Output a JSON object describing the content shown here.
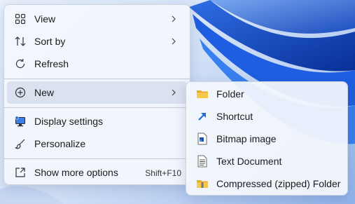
{
  "context_menu": {
    "items": [
      {
        "label": "View",
        "icon": "grid-icon",
        "submenu": true
      },
      {
        "label": "Sort by",
        "icon": "sort-arrows-icon",
        "submenu": true
      },
      {
        "label": "Refresh",
        "icon": "refresh-icon",
        "submenu": false
      },
      {
        "label": "New",
        "icon": "plus-circle-icon",
        "submenu": true,
        "highlighted": true
      },
      {
        "label": "Display settings",
        "icon": "display-icon",
        "submenu": false
      },
      {
        "label": "Personalize",
        "icon": "brush-icon",
        "submenu": false
      },
      {
        "label": "Show more options",
        "icon": "expand-icon",
        "shortcut": "Shift+F10"
      }
    ]
  },
  "new_submenu": {
    "items": [
      {
        "label": "Folder",
        "icon": "folder-icon"
      },
      {
        "label": "Shortcut",
        "icon": "shortcut-icon"
      },
      {
        "label": "Bitmap image",
        "icon": "bitmap-icon"
      },
      {
        "label": "Text Document",
        "icon": "text-document-icon"
      },
      {
        "label": "Compressed (zipped) Folder",
        "icon": "zip-folder-icon"
      }
    ]
  },
  "colors": {
    "accent": "#0067c0",
    "folder": "#f4c242",
    "wallpaper_blue": "#1a56d6"
  }
}
